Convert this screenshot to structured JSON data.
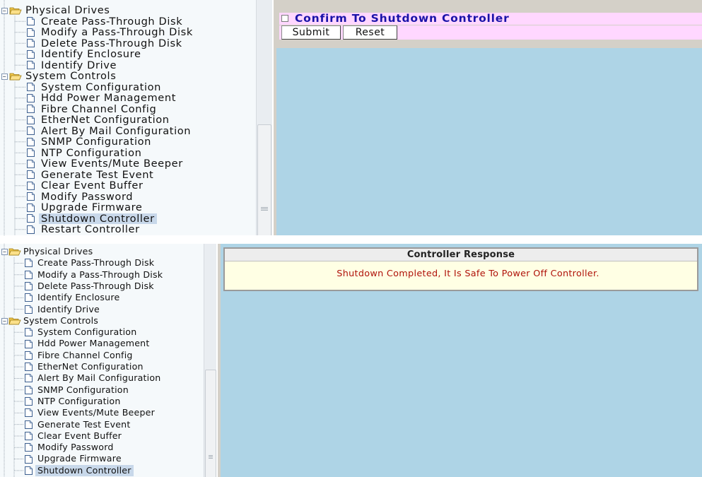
{
  "tree": {
    "physical_drives": "Physical Drives",
    "physical_items": [
      "Create Pass-Through Disk",
      "Modify a Pass-Through Disk",
      "Delete Pass-Through Disk",
      "Identify Enclosure",
      "Identify Drive"
    ],
    "system_controls": "System Controls",
    "system_items": [
      "System Configuration",
      "Hdd Power Management",
      "Fibre Channel Config",
      "EtherNet Configuration",
      "Alert By Mail Configuration",
      "SNMP Configuration",
      "NTP Configuration",
      "View Events/Mute Beeper",
      "Generate Test Event",
      "Clear Event Buffer",
      "Modify Password",
      "Upgrade Firmware",
      "Shutdown Controller",
      "Restart Controller"
    ],
    "expander_symbol": "−"
  },
  "shutdown_form": {
    "confirm_label": "Confirm To Shutdown Controller",
    "confirm_checked": false,
    "submit_label": "Submit",
    "reset_label": "Reset"
  },
  "response": {
    "header": "Controller Response",
    "message": "Shutdown Completed, It Is Safe To Power Off Controller."
  },
  "colors": {
    "content_background": "#aed4e6",
    "confirm_background": "#ffd7ff",
    "confirm_text": "#1a13a8",
    "response_text": "#b0120a",
    "selected_item": "#c8d8ea"
  }
}
